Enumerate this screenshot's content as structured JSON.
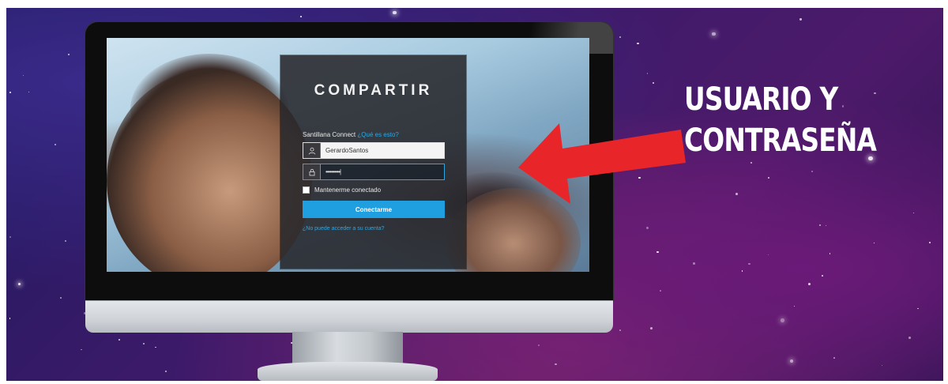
{
  "login": {
    "brand": "COMPARTIR",
    "connect_label": "Santillana Connect",
    "connect_link": "¿Qué es esto?",
    "username_value": "GerardoSantos",
    "password_masked": "••••••••••|",
    "remember_label": "Mantenerme conectado",
    "submit_label": "Conectarme",
    "help_link": "¿No puede acceder a su cuenta?"
  },
  "callout": {
    "line1": "USUARIO Y",
    "line2": "CONTRASEÑA"
  },
  "icons": {
    "user": "user-icon",
    "lock": "lock-icon",
    "arrow": "red-arrow-icon"
  },
  "colors": {
    "accent": "#1f9fe0",
    "arrow": "#e8262a",
    "panel": "#28282c"
  }
}
